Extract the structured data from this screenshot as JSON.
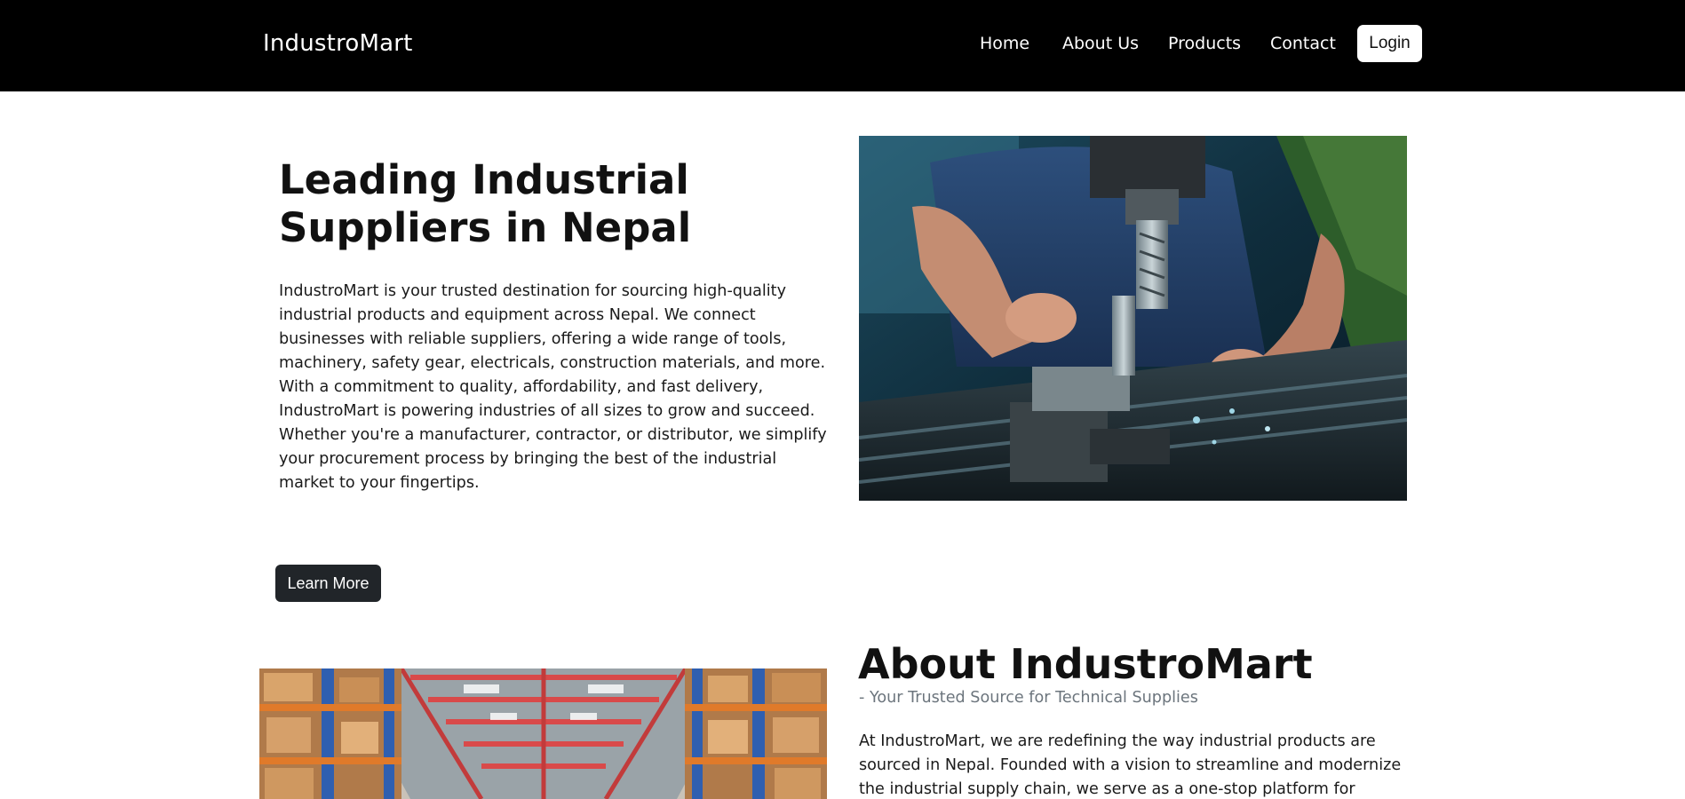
{
  "header": {
    "brand": "IndustroMart",
    "nav": {
      "home": "Home",
      "about": "About Us",
      "products": "Products",
      "contact": "Contact"
    },
    "login_label": "Login"
  },
  "hero": {
    "title": "Leading Industrial Suppliers in Nepal",
    "description": "IndustroMart is your trusted destination for sourcing high-quality industrial products and equipment across Nepal. We connect businesses with reliable suppliers, offering a wide range of tools, machinery, safety gear, electricals, construction materials, and more. With a commitment to quality, affordability, and fast delivery, IndustroMart is powering industries of all sizes to grow and succeed. Whether you're a manufacturer, contractor, or distributor, we simplify your procurement process by bringing the best of the industrial market to your fingertips.",
    "button_label": "Learn More"
  },
  "about": {
    "title": "About IndustroMart",
    "subtitle": "- Your Trusted Source for Technical Supplies",
    "text": "At IndustroMart, we are redefining the way industrial products are sourced in Nepal. Founded with a vision to streamline and modernize the industrial supply chain, we serve as a one-stop platform for businesses seeking reliable, high-"
  }
}
